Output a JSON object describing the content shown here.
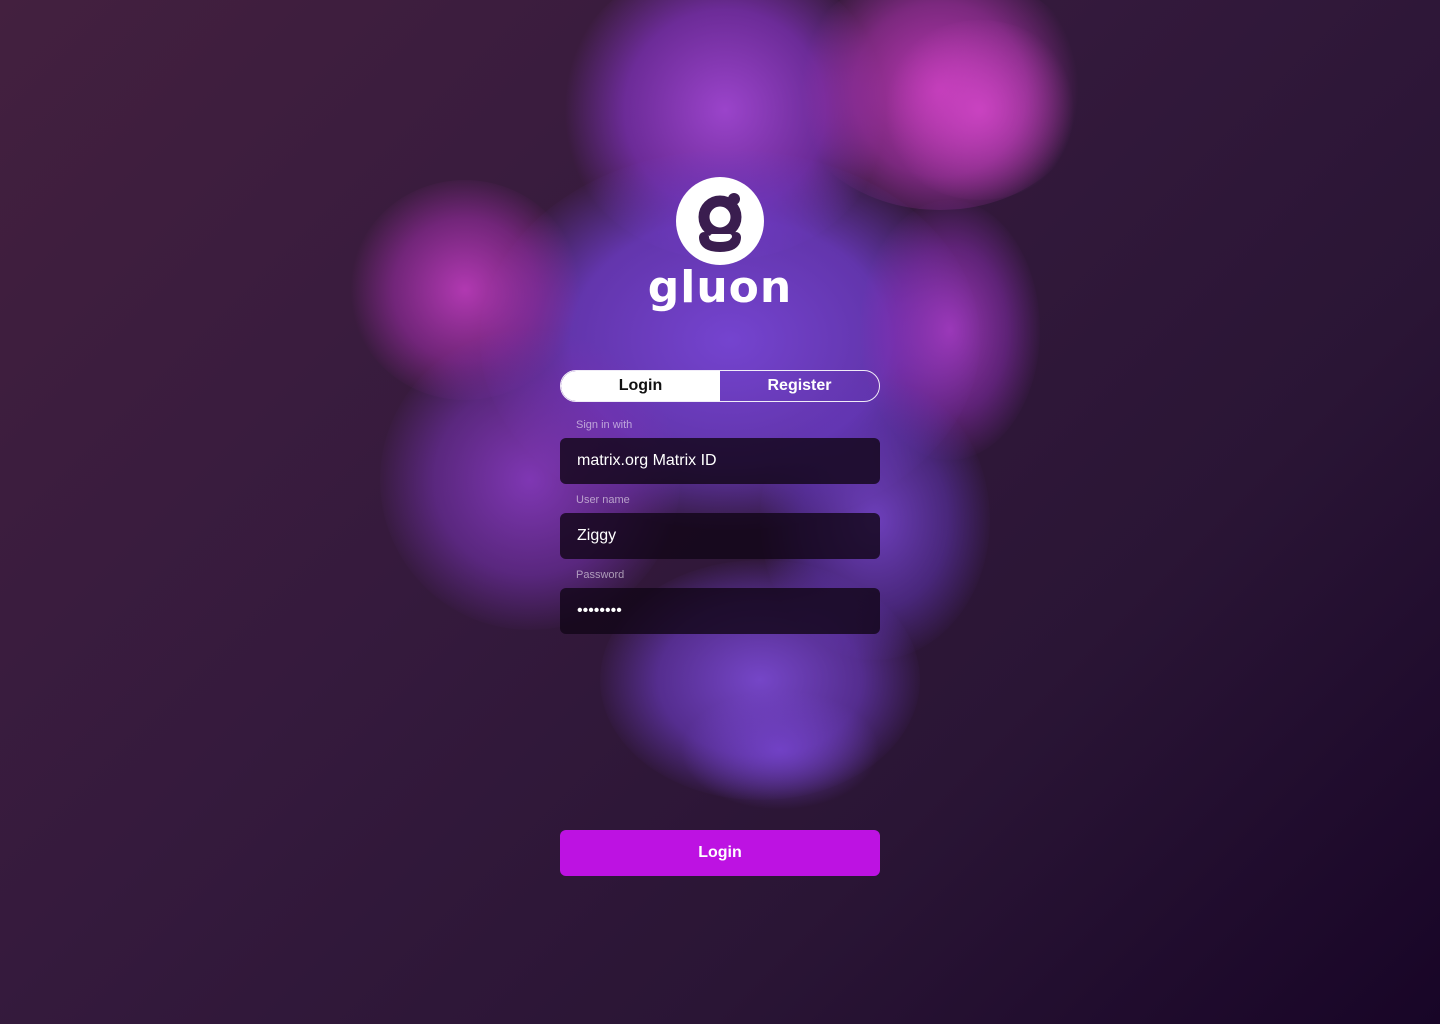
{
  "app": {
    "logo_text": "gluon",
    "logo_icon": "g-letter-icon"
  },
  "tabs": {
    "login_label": "Login",
    "register_label": "Register",
    "active": "Login"
  },
  "form": {
    "sign_in_label": "Sign in with",
    "sign_in_value": "matrix.org Matrix ID",
    "username_label": "User name",
    "username_value": "Ziggy",
    "password_label": "Password",
    "password_value": "••••••••"
  },
  "actions": {
    "login_button_label": "Login"
  },
  "colors": {
    "accent": "#bd12e2",
    "background_dark": "#180527",
    "background_light": "#43203f",
    "smoke_purple": "#7b3fd0",
    "smoke_magenta": "#b53ab8"
  }
}
